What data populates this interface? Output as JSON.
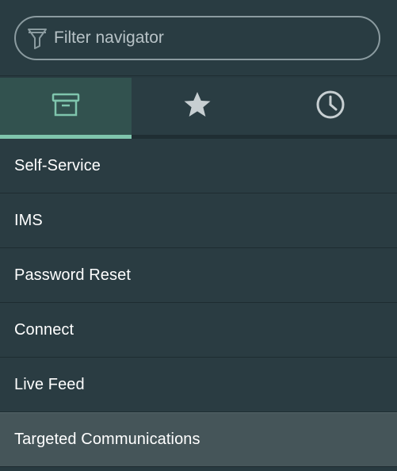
{
  "filter": {
    "placeholder": "Filter navigator",
    "icon": "filter-icon"
  },
  "tabs": [
    {
      "name": "all-applications",
      "icon": "archive-box-icon",
      "active": true
    },
    {
      "name": "favorites",
      "icon": "star-icon",
      "active": false
    },
    {
      "name": "history",
      "icon": "clock-icon",
      "active": false
    }
  ],
  "menu": {
    "items": [
      {
        "label": "Self-Service"
      },
      {
        "label": "IMS"
      },
      {
        "label": "Password Reset"
      },
      {
        "label": "Connect"
      },
      {
        "label": "Live Feed"
      },
      {
        "label": "Targeted Communications",
        "highlighted": true
      }
    ]
  },
  "colors": {
    "background": "#283a40",
    "active_tab": "#32524f",
    "accent": "#7fc5ad",
    "highlight_row": "#455559",
    "text": "#ffffff"
  }
}
